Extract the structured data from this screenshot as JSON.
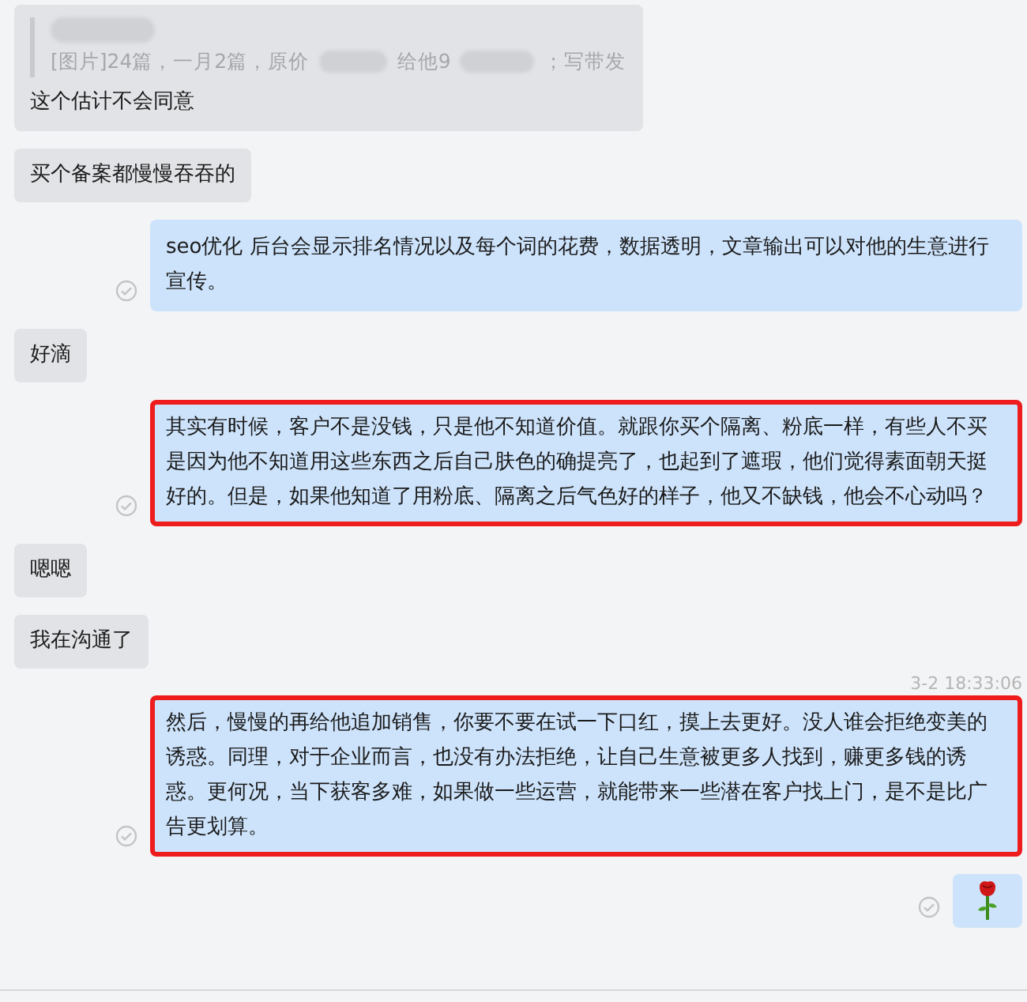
{
  "messages": [
    {
      "kind": "quote",
      "quote": {
        "segments": [
          "[图片]24篇，一月2篇，原价",
          "给他9",
          "；写带发"
        ]
      },
      "text": "这个估计不会同意"
    },
    {
      "kind": "incoming",
      "text": "买个备案都慢慢吞吞的"
    },
    {
      "kind": "outgoing",
      "text": "seo优化 后台会显示排名情况以及每个词的花费，数据透明，文章输出可以对他的生意进行宣传。",
      "highlighted": false
    },
    {
      "kind": "incoming",
      "text": "好滴"
    },
    {
      "kind": "outgoing",
      "text": "其实有时候，客户不是没钱，只是他不知道价值。就跟你买个隔离、粉底一样，有些人不买是因为他不知道用这些东西之后自己肤色的确提亮了，也起到了遮瑕，他们觉得素面朝天挺好的。但是，如果他知道了用粉底、隔离之后气色好的样子，他又不缺钱，他会不心动吗？",
      "highlighted": true
    },
    {
      "kind": "incoming",
      "text": "嗯嗯"
    },
    {
      "kind": "incoming",
      "text": "我在沟通了"
    },
    {
      "kind": "time",
      "text": "3-2 18:33:06"
    },
    {
      "kind": "outgoing",
      "text": "然后，慢慢的再给他追加销售，你要不要在试一下口红，摸上去更好。没人谁会拒绝变美的诱惑。同理，对于企业而言，也没有办法拒绝，让自己生意被更多人找到，赚更多钱的诱惑。更何况，当下获客多难，如果做一些运营，就能带来一些潜在客户找上门，是不是比广告更划算。",
      "highlighted": true
    },
    {
      "kind": "rose"
    }
  ]
}
